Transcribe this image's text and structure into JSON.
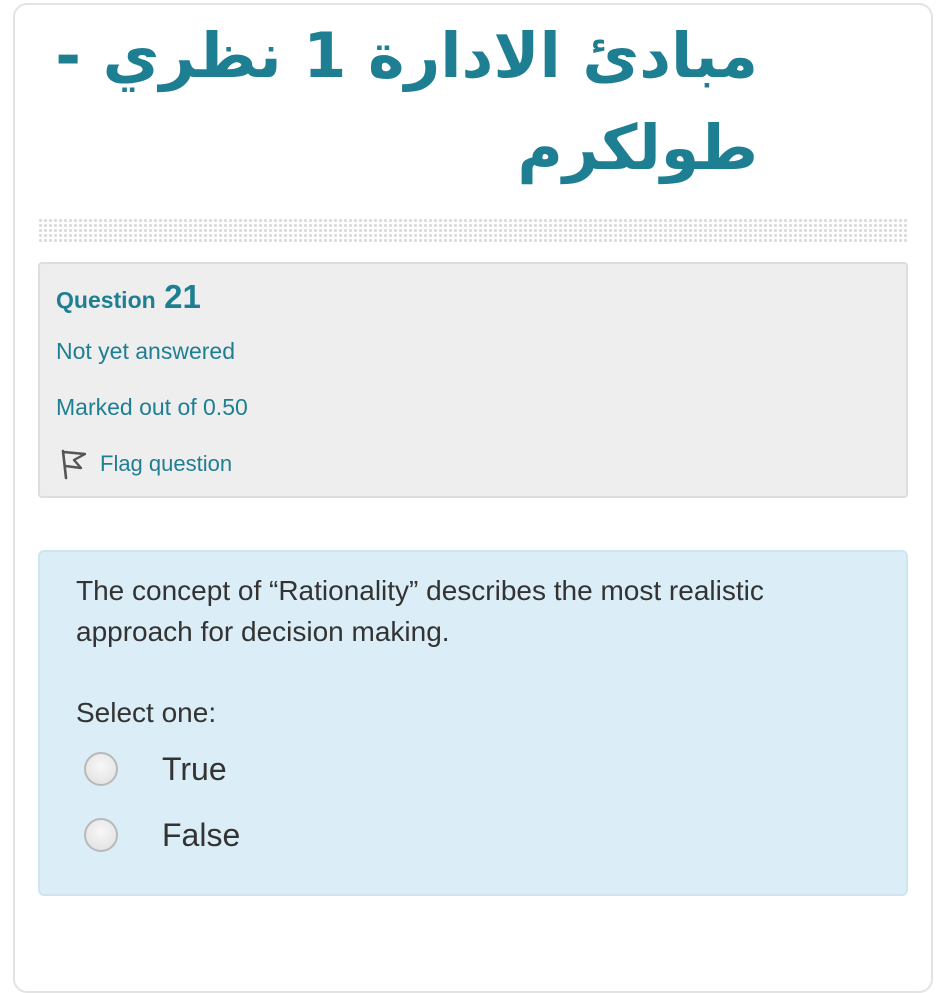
{
  "course": {
    "title": "مبادئ الادارة 1 نظري - طولكرم"
  },
  "question_info": {
    "label": "Question",
    "number": "21",
    "state": "Not yet answered",
    "grade": "Marked out of 0.50",
    "flag_label": "Flag question",
    "flag_icon": "flag-icon"
  },
  "question": {
    "text": "The concept of “Rationality” describes the most realistic approach for decision making.",
    "prompt": "Select one:",
    "options": [
      {
        "label": "True",
        "selected": false
      },
      {
        "label": "False",
        "selected": false
      }
    ]
  },
  "colors": {
    "accent": "#1f7f92",
    "info_bg": "#eeeeee",
    "formulation_bg": "#dbedf6",
    "text": "#333333"
  }
}
